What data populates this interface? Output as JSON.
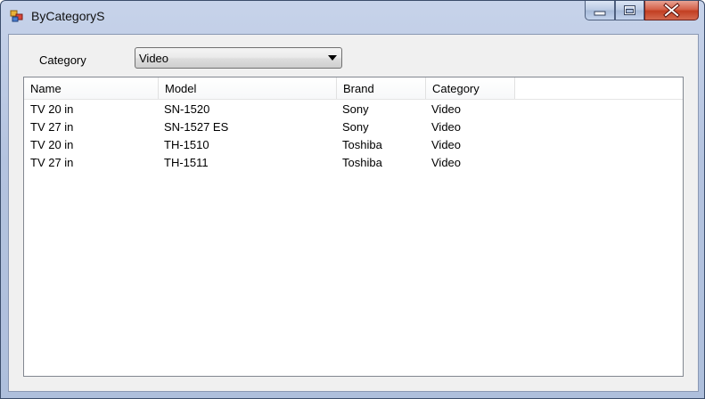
{
  "window": {
    "title": "ByCategoryS",
    "controls": {
      "minimize": "minimize",
      "maximize": "maximize",
      "close": "close"
    }
  },
  "filter": {
    "label": "Category",
    "selected": "Video"
  },
  "table": {
    "columns": [
      "Name",
      "Model",
      "Brand",
      "Category"
    ],
    "rows": [
      [
        "TV 20 in",
        "SN-1520",
        "Sony",
        "Video"
      ],
      [
        "TV 27 in",
        "SN-1527 ES",
        "Sony",
        "Video"
      ],
      [
        "TV 20 in",
        "TH-1510",
        "Toshiba",
        "Video"
      ],
      [
        "TV 27 in",
        "TH-1511",
        "Toshiba",
        "Video"
      ]
    ]
  },
  "icons": {
    "app": "app-icon",
    "minimize": "minimize-icon",
    "maximize": "maximize-icon",
    "close": "close-icon",
    "dropdown": "chevron-down-icon"
  },
  "colors": {
    "titlebar": "#b4c3df",
    "close_button": "#c23f22",
    "client": "#f0f0f0"
  }
}
